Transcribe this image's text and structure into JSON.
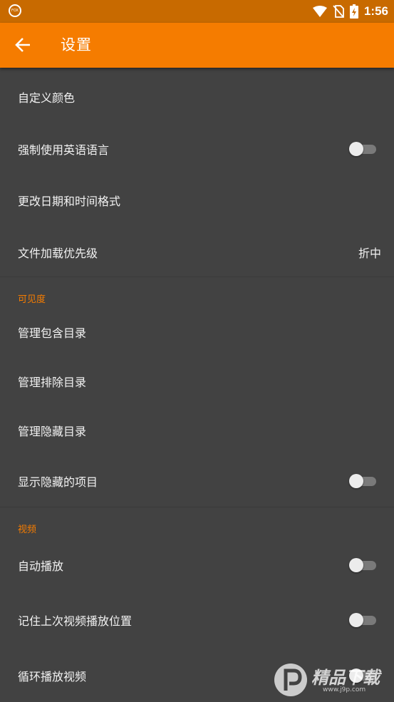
{
  "status_bar": {
    "time": "1:56",
    "icons": [
      "app-notification-icon",
      "wifi-icon",
      "no-sim-icon",
      "battery-charging-icon"
    ],
    "app_icon_label": "FOX"
  },
  "toolbar": {
    "title": "设置",
    "back_icon": "arrow-back-icon"
  },
  "sections": {
    "general": {
      "items": [
        {
          "label": "自定义颜色"
        },
        {
          "label": "强制使用英语语言",
          "toggle": false
        },
        {
          "label": "更改日期和时间格式"
        },
        {
          "label": "文件加载优先级",
          "value": "折中"
        }
      ]
    },
    "visibility": {
      "header": "可见度",
      "items": [
        {
          "label": "管理包含目录"
        },
        {
          "label": "管理排除目录"
        },
        {
          "label": "管理隐藏目录"
        },
        {
          "label": "显示隐藏的项目",
          "toggle": false
        }
      ]
    },
    "video": {
      "header": "视频",
      "items": [
        {
          "label": "自动播放",
          "toggle": false
        },
        {
          "label": "记住上次视频播放位置",
          "toggle": false
        },
        {
          "label": "循环播放视频",
          "toggle": false
        }
      ]
    }
  },
  "watermark": {
    "text": "精品下载",
    "url": "www.j9p.com"
  },
  "colors": {
    "accent": "#f57c00",
    "status_bar": "#c86a00",
    "background": "#424242"
  }
}
